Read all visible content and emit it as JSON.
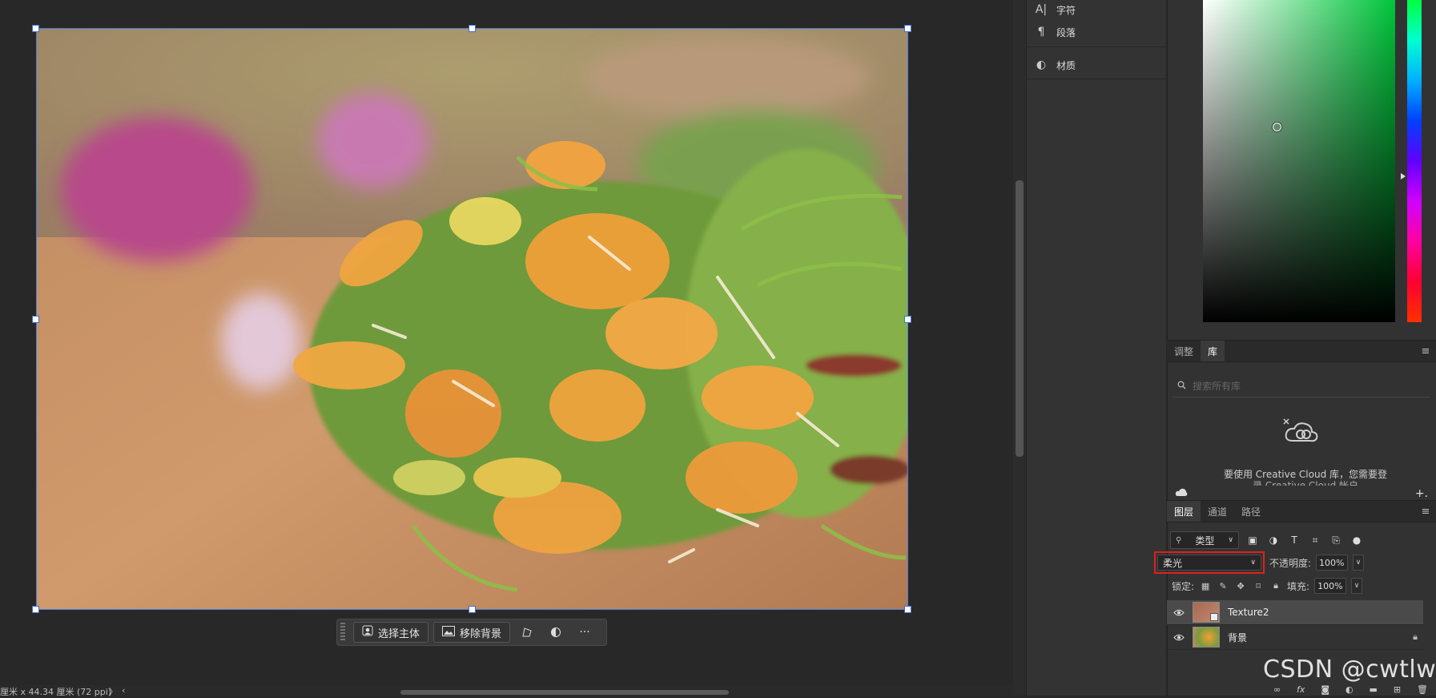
{
  "canvas": {
    "status_text": "厘米 x 44.34 厘米 (72 ppi)",
    "status_arrow": "〉",
    "status_arrow_left": "‹"
  },
  "float_bar": {
    "select_subject_label": "选择主体",
    "remove_background_label": "移除背景",
    "more_label": "···"
  },
  "mid_panel": {
    "items": [
      {
        "icon": "character-icon",
        "glyph": "A|",
        "label": "字符"
      },
      {
        "icon": "paragraph-icon",
        "glyph": "¶",
        "label": "段落"
      },
      {
        "icon": "material-icon",
        "glyph": "◐",
        "label": "材质"
      }
    ]
  },
  "color_panel": {
    "accent": "#00c43a"
  },
  "library_panel": {
    "tabs": [
      "调整",
      "库"
    ],
    "active_tab": "库",
    "search_placeholder": "搜索所有库",
    "message": "要使用 Creative Cloud 库，您需要登",
    "message_cont": "录 Creative Cloud 帐户",
    "add_label": "+."
  },
  "layers_panel": {
    "tabs": [
      "图层",
      "通道",
      "路径"
    ],
    "active_tab": "图层",
    "filter_kind": "类型",
    "blend_mode": "柔光",
    "opacity_label": "不透明度:",
    "opacity_value": "100%",
    "lock_label": "锁定:",
    "fill_label": "填充:",
    "fill_value": "100%",
    "layers": [
      {
        "name": "Texture2",
        "selected": true,
        "locked": false
      },
      {
        "name": "背景",
        "selected": false,
        "locked": true
      }
    ],
    "footer_icons": [
      "link-icon",
      "fx-icon",
      "mask-icon",
      "adjustment-icon",
      "group-icon",
      "new-layer-icon",
      "delete-icon"
    ],
    "fx_label": "fx"
  },
  "watermark": "CSDN @cwtlw",
  "highlight_color": "#e0201e"
}
